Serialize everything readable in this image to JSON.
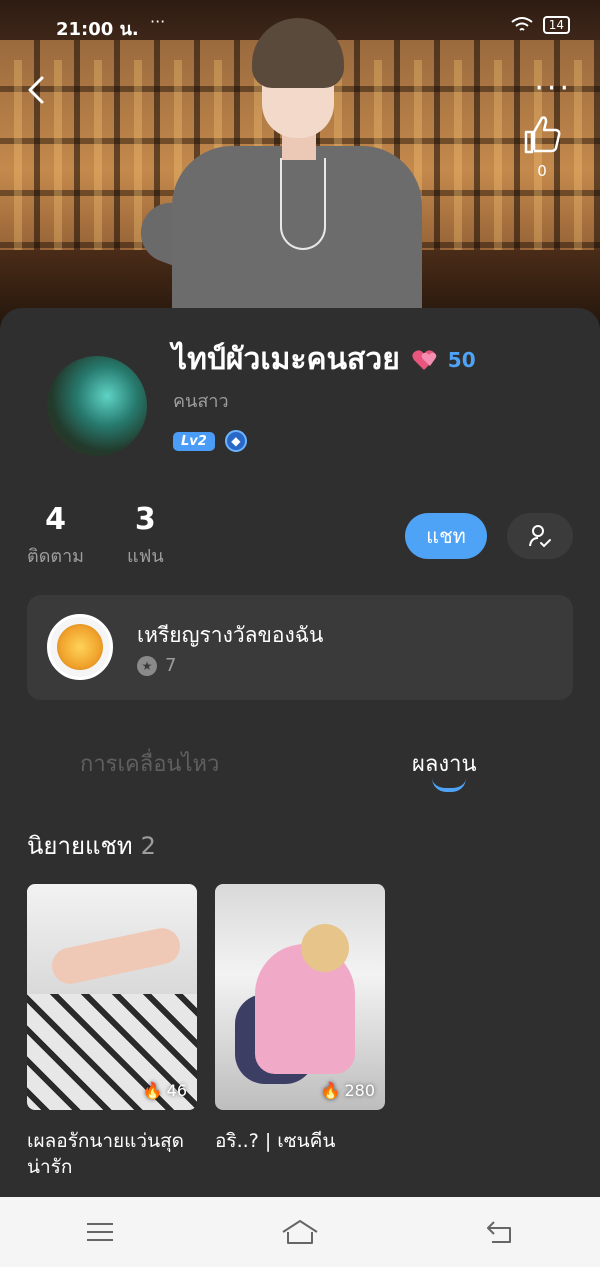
{
  "status_bar": {
    "time": "21:00 น.",
    "dots": "···",
    "battery": "14"
  },
  "header": {
    "like_count": "0"
  },
  "profile": {
    "name": "ไทป์ผัวเมะคนสวย",
    "hearts": "50",
    "subtitle": "คนสาว",
    "level": "Lv2",
    "stats": [
      {
        "value": "4",
        "label": "ติดตาม"
      },
      {
        "value": "3",
        "label": "แฟน"
      }
    ],
    "chat_label": "แชท"
  },
  "medals": {
    "title": "เหรียญรางวัลของฉัน",
    "count": "7"
  },
  "tabs": {
    "activity": "การเคลื่อนไหว",
    "works": "ผลงาน"
  },
  "section": {
    "title": "นิยายแชท",
    "count": "2"
  },
  "stories": [
    {
      "title": "เผลอรักนายแว่นสุดน่ารัก",
      "views": "46"
    },
    {
      "title": "อริ..? | เซนคีน",
      "views": "280"
    }
  ],
  "colors": {
    "accent": "#4fa3f7",
    "panel": "#2f2f2f",
    "card": "#3a3a3a"
  }
}
